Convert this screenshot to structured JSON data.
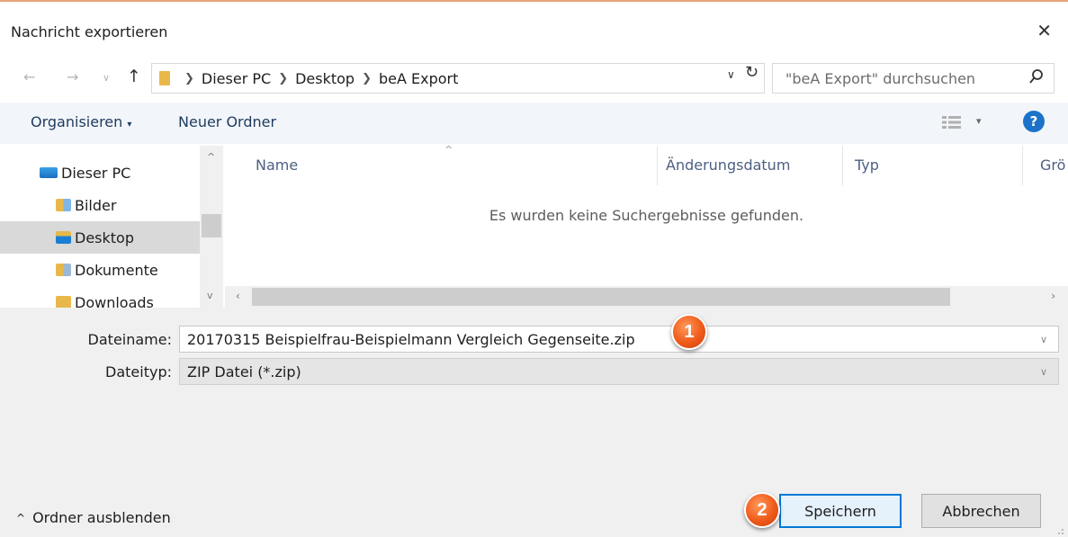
{
  "window": {
    "title": "Nachricht exportieren"
  },
  "nav": {
    "breadcrumb": [
      "Dieser PC",
      "Desktop",
      "beA Export"
    ],
    "search_placeholder": "\"beA Export\" durchsuchen"
  },
  "toolbar": {
    "organize_label": "Organisieren",
    "new_folder_label": "Neuer Ordner"
  },
  "navpane": {
    "items": [
      {
        "label": "Dieser PC",
        "icon": "computer-icon",
        "selected": false
      },
      {
        "label": "Bilder",
        "icon": "pictures-folder-icon",
        "selected": false
      },
      {
        "label": "Desktop",
        "icon": "desktop-folder-icon",
        "selected": true
      },
      {
        "label": "Dokumente",
        "icon": "documents-folder-icon",
        "selected": false
      },
      {
        "label": "Downloads",
        "icon": "downloads-folder-icon",
        "selected": false
      }
    ]
  },
  "filelist": {
    "columns": [
      "Name",
      "Änderungsdatum",
      "Typ",
      "Grö"
    ],
    "empty_message": "Es wurden keine Suchergebnisse gefunden."
  },
  "form": {
    "filename_label": "Dateiname:",
    "filename_value": "20170315 Beispielfrau-Beispielmann Vergleich Gegenseite.zip",
    "filetype_label": "Dateityp:",
    "filetype_value": "ZIP Datei (*.zip)"
  },
  "footer": {
    "toggle_label": "Ordner ausblenden",
    "save_label": "Speichern",
    "cancel_label": "Abbrechen"
  },
  "annotations": {
    "badge1": "1",
    "badge2": "2"
  },
  "colors": {
    "accent": "#0078d7",
    "badge": "#f05a1a",
    "selection": "#d9d9d9",
    "help": "#1a73c8"
  }
}
